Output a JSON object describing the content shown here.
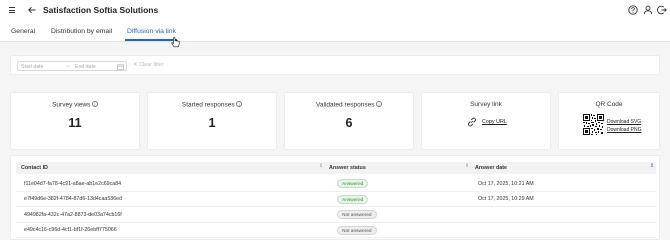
{
  "header": {
    "title": "Satisfaction Softia Solutions",
    "icons": [
      "menu-icon",
      "back-arrow-icon",
      "help-icon",
      "user-icon",
      "logout-icon"
    ]
  },
  "tabs": [
    {
      "label": "General",
      "active": false
    },
    {
      "label": "Distribution by email",
      "active": false
    },
    {
      "label": "Diffusion via link",
      "active": true
    }
  ],
  "filter": {
    "start_placeholder": "Start date",
    "arrow": "→",
    "end_placeholder": "End date",
    "clear_label": "Clear filter"
  },
  "stats": {
    "survey_views": {
      "label": "Survey views",
      "value": "11"
    },
    "started_responses": {
      "label": "Started responses",
      "value": "1"
    },
    "validated_responses": {
      "label": "Validated responses",
      "value": "6"
    },
    "survey_link": {
      "label": "Survey link",
      "action": "Copy URL"
    },
    "qr_code": {
      "label": "QR Code",
      "download_svg": "Download SVG",
      "download_png": "Download PNG"
    }
  },
  "table": {
    "columns": [
      "Contact ID",
      "Answer status",
      "Answer date"
    ],
    "rows": [
      {
        "contact_id": "f11e04d7-fa78-4c91-a8ae-ab1e2c69ca84",
        "status": "Answered",
        "date": "Oct 17, 2025, 10:21 AM"
      },
      {
        "contact_id": "e7f49d6e-382f-4784-87d6-13d4caa536ed",
        "status": "Answered",
        "date": "Oct 17, 2025, 10:29 AM"
      },
      {
        "contact_id": "494982fa-432c-47a2-8873-de03a74cb16f",
        "status": "Not answered",
        "date": ""
      },
      {
        "contact_id": "e49c4c16-c96d-4cf1-bf1f-26ebff775066",
        "status": "Not answered",
        "date": ""
      }
    ]
  },
  "colors": {
    "accent": "#1f63d6",
    "answered_bg": "#e8f5e9",
    "answered_text": "#3c8a41",
    "not_answered_bg": "#eeeeee"
  }
}
